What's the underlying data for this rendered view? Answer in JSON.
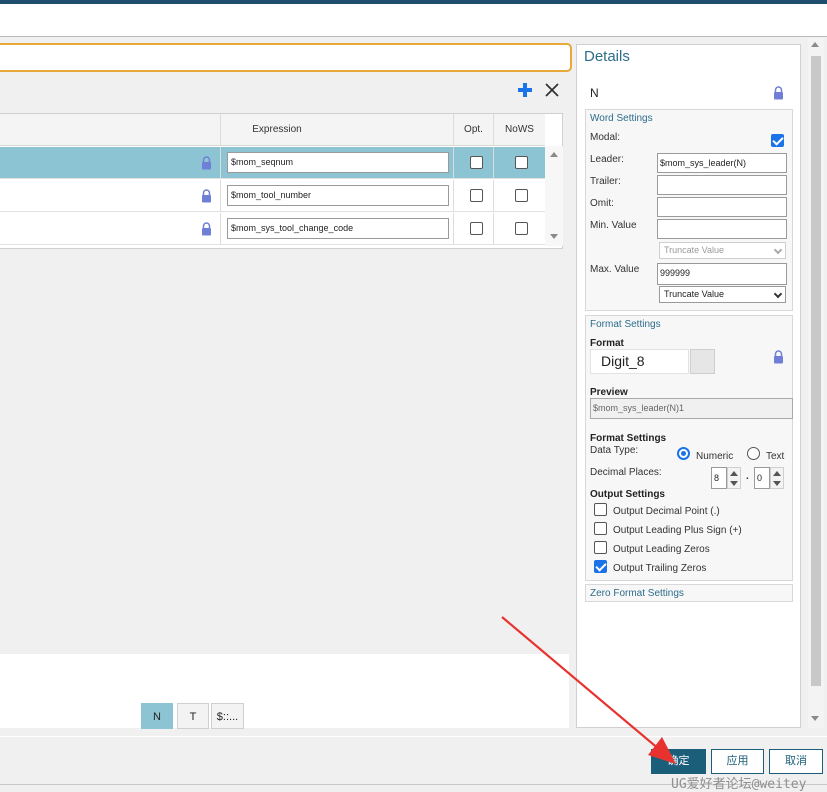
{
  "table": {
    "headers": {
      "expression": "Expression",
      "opt": "Opt.",
      "nows": "NoWS"
    },
    "rows": [
      {
        "expression": "$mom_seqnum",
        "opt": false,
        "nows": false,
        "selected": true
      },
      {
        "expression": "$mom_tool_number",
        "opt": false,
        "nows": false,
        "selected": false
      },
      {
        "expression": "$mom_sys_tool_change_code",
        "opt": false,
        "nows": false,
        "selected": false
      }
    ]
  },
  "tabs": [
    {
      "label": "N",
      "active": true
    },
    {
      "label": "T",
      "active": false
    },
    {
      "label": "$::...",
      "active": false
    }
  ],
  "details": {
    "title": "Details",
    "word_name": "N",
    "word_settings": {
      "header": "Word Settings",
      "modal_label": "Modal:",
      "modal_checked": true,
      "leader_label": "Leader:",
      "leader_value": "$mom_sys_leader(N)",
      "trailer_label": "Trailer:",
      "trailer_value": "",
      "omit_label": "Omit:",
      "omit_value": "",
      "min_label": "Min. Value",
      "min_value": "",
      "min_select": "Truncate Value",
      "max_label": "Max. Value",
      "max_value": "999999",
      "max_select": "Truncate Value"
    },
    "format_settings": {
      "header": "Format Settings",
      "format_label": "Format",
      "format_value": "Digit_8",
      "preview_label": "Preview",
      "preview_value": "$mom_sys_leader(N)1",
      "settings_label": "Format Settings",
      "data_type_label": "Data Type:",
      "numeric_label": "Numeric",
      "text_label": "Text",
      "data_type_selected": "Numeric",
      "decimal_places_label": "Decimal Places:",
      "decimal_left": "8",
      "decimal_sep": ".",
      "decimal_right": "0",
      "output_label": "Output Settings",
      "outputs": [
        {
          "label": "Output Decimal Point (.)",
          "checked": false
        },
        {
          "label": "Output Leading Plus Sign (+)",
          "checked": false
        },
        {
          "label": "Output Leading Zeros",
          "checked": false
        },
        {
          "label": "Output Trailing Zeros",
          "checked": true
        }
      ]
    },
    "zero_format": {
      "header": "Zero Format Settings"
    }
  },
  "footer": {
    "ok": "确定",
    "apply": "应用",
    "cancel": "取消"
  },
  "watermark": "UG爱好者论坛@weitey",
  "colors": {
    "accent": "#1b5e7a",
    "selected_row": "#8dc4d3",
    "highlight_border": "#e8a93b",
    "annotation_arrow": "#e8322f"
  }
}
